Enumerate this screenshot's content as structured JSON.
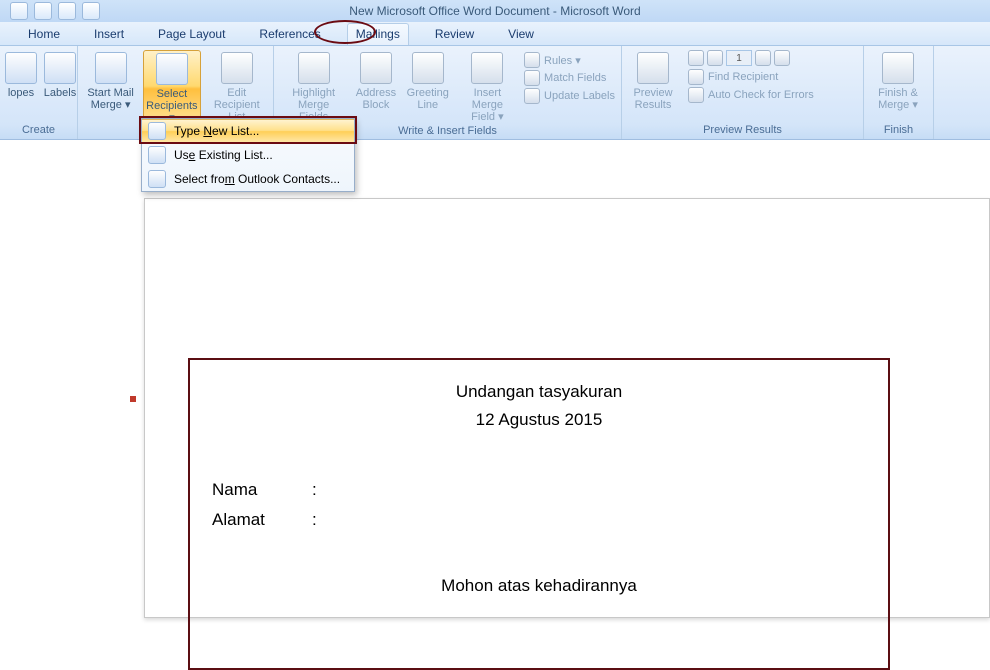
{
  "window": {
    "title": "New Microsoft Office Word Document - Microsoft Word"
  },
  "tabs": {
    "home": "Home",
    "insert": "Insert",
    "page_layout": "Page Layout",
    "references": "References",
    "mailings": "Mailings",
    "review": "Review",
    "view": "View"
  },
  "ribbon": {
    "create": {
      "label": "Create",
      "envelopes": "lopes",
      "labels": "Labels"
    },
    "start": {
      "start_mail_merge": "Start Mail Merge ▾",
      "select_recipients": "Select Recipients ▾",
      "edit_recipient_list": "Edit Recipient List"
    },
    "write": {
      "label": "Write & Insert Fields",
      "highlight": "Highlight Merge Fields",
      "address": "Address Block",
      "greeting": "Greeting Line",
      "insert_merge": "Insert Merge Field ▾",
      "rules": "Rules ▾",
      "match": "Match Fields",
      "update": "Update Labels"
    },
    "preview": {
      "label": "Preview Results",
      "preview_results": "Preview Results",
      "record": "1",
      "find": "Find Recipient",
      "auto": "Auto Check for Errors"
    },
    "finish": {
      "label": "Finish",
      "finish_merge": "Finish & Merge ▾"
    }
  },
  "dropdown": {
    "type_new": "Type New List...",
    "use_existing": "Use Existing List...",
    "outlook": "Select from Outlook Contacts..."
  },
  "document": {
    "title": "Undangan tasyakuran",
    "date": "12 Agustus 2015",
    "nama_label": "Nama",
    "alamat_label": "Alamat",
    "colon": ":",
    "footer": "Mohon atas kehadirannya"
  }
}
